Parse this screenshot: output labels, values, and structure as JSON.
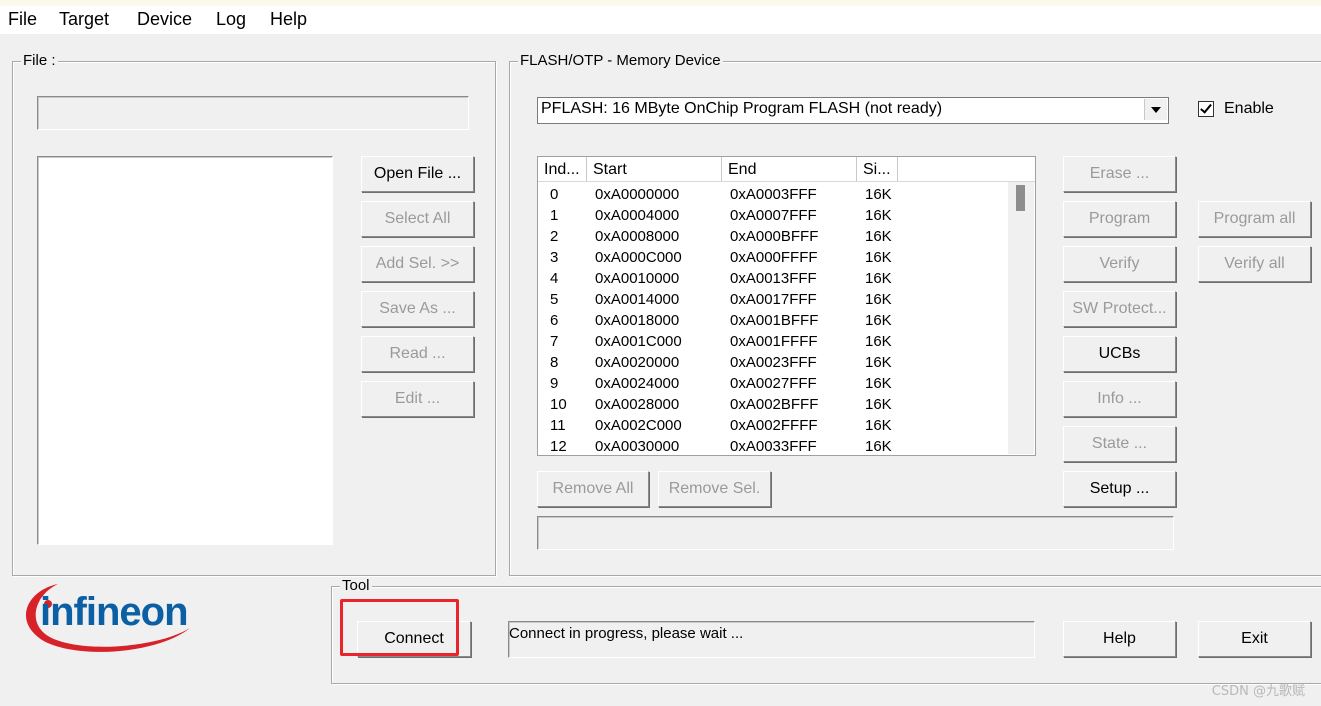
{
  "menu": [
    "File",
    "Target",
    "Device",
    "Log",
    "Help"
  ],
  "file_group": {
    "title": "File :",
    "path_value": "",
    "buttons": {
      "open_file": "Open File ...",
      "select_all": "Select All",
      "add_sel": "Add Sel. >>",
      "save_as": "Save As ...",
      "read": "Read ...",
      "edit": "Edit ..."
    }
  },
  "flash_group": {
    "title": "FLASH/OTP - Memory Device",
    "device_select": "PFLASH: 16 MByte OnChip Program FLASH  (not ready)",
    "enable_label": "Enable",
    "enable_checked": true,
    "columns": [
      "Ind...",
      "Start",
      "End",
      "Si..."
    ],
    "sectors": [
      [
        "0",
        "0xA0000000",
        "0xA0003FFF",
        "16K"
      ],
      [
        "1",
        "0xA0004000",
        "0xA0007FFF",
        "16K"
      ],
      [
        "2",
        "0xA0008000",
        "0xA000BFFF",
        "16K"
      ],
      [
        "3",
        "0xA000C000",
        "0xA000FFFF",
        "16K"
      ],
      [
        "4",
        "0xA0010000",
        "0xA0013FFF",
        "16K"
      ],
      [
        "5",
        "0xA0014000",
        "0xA0017FFF",
        "16K"
      ],
      [
        "6",
        "0xA0018000",
        "0xA001BFFF",
        "16K"
      ],
      [
        "7",
        "0xA001C000",
        "0xA001FFFF",
        "16K"
      ],
      [
        "8",
        "0xA0020000",
        "0xA0023FFF",
        "16K"
      ],
      [
        "9",
        "0xA0024000",
        "0xA0027FFF",
        "16K"
      ],
      [
        "10",
        "0xA0028000",
        "0xA002BFFF",
        "16K"
      ],
      [
        "11",
        "0xA002C000",
        "0xA002FFFF",
        "16K"
      ],
      [
        "12",
        "0xA0030000",
        "0xA0033FFF",
        "16K"
      ]
    ],
    "buttons": {
      "remove_all": "Remove All",
      "remove_sel": "Remove Sel.",
      "erase": "Erase ...",
      "program": "Program",
      "verify": "Verify",
      "sw_protect": "SW Protect...",
      "ucbs": "UCBs",
      "info": "Info ...",
      "state": "State ...",
      "setup": "Setup ...",
      "program_all": "Program all",
      "verify_all": "Verify all"
    },
    "status_value": ""
  },
  "tool_group": {
    "title": "Tool",
    "connect": "Connect",
    "status": "Connect in progress, please wait ..."
  },
  "footer": {
    "help": "Help",
    "exit": "Exit"
  },
  "logo_text": "infineon",
  "watermark": "CSDN @九歌赋",
  "colors": {
    "logo_blue": "#0b5fa5",
    "logo_red": "#d8222a",
    "highlight": "#e8252a"
  }
}
